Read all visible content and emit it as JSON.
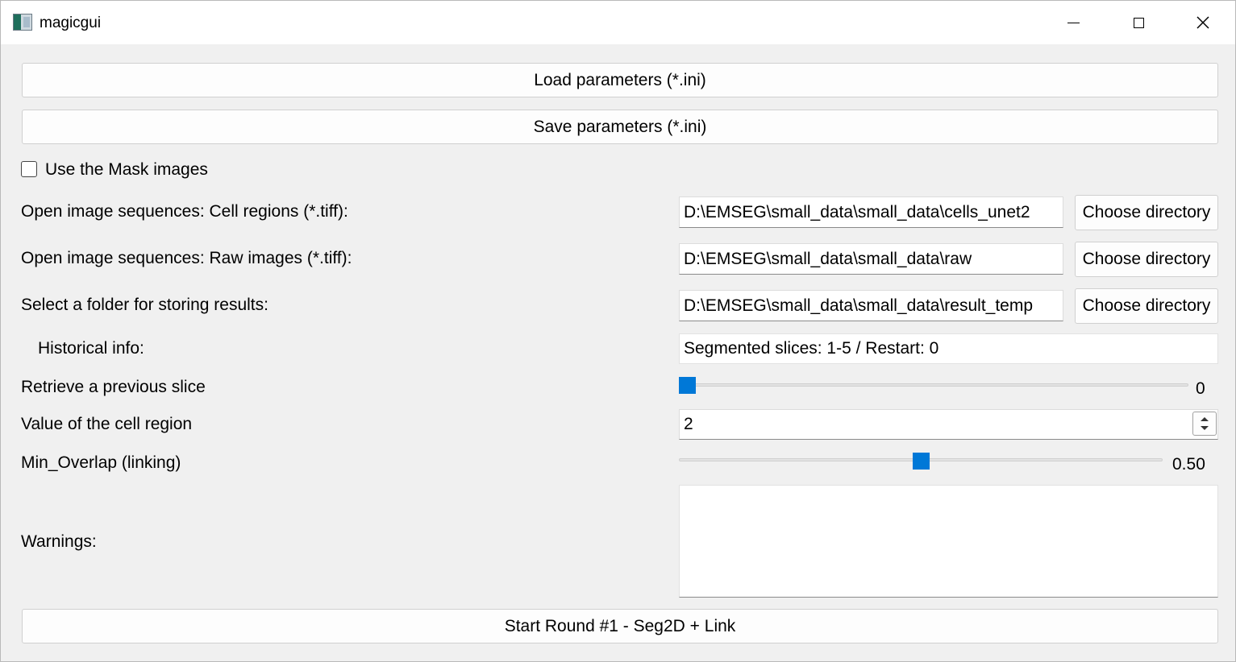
{
  "window": {
    "title": "magicgui"
  },
  "buttons": {
    "load_params": "Load parameters (*.ini)",
    "save_params": "Save parameters (*.ini)",
    "start_round": "Start Round #1 - Seg2D + Link"
  },
  "mask_checkbox": {
    "label": "Use the Mask images",
    "checked": false
  },
  "fields": {
    "cell_regions": {
      "label": "Open image sequences: Cell regions (*.tiff):",
      "value": "D:\\EMSEG\\small_data\\small_data\\cells_unet2",
      "button": "Choose directory"
    },
    "raw_images": {
      "label": "Open image sequences: Raw images (*.tiff):",
      "value": "D:\\EMSEG\\small_data\\small_data\\raw",
      "button": "Choose directory"
    },
    "results_folder": {
      "label": "Select a folder for storing results:",
      "value": "D:\\EMSEG\\small_data\\small_data\\result_temp",
      "button": "Choose directory"
    }
  },
  "historical_info": {
    "label": "Historical info:",
    "value": "Segmented slices: 1-5 / Restart: 0"
  },
  "retrieve_slice": {
    "label": "Retrieve a previous slice",
    "value": "0",
    "min": 0,
    "max": 100,
    "current": 0
  },
  "cell_region_value": {
    "label": "Value of the cell region",
    "value": "2"
  },
  "min_overlap": {
    "label": "Min_Overlap (linking)",
    "value": "0.50",
    "fraction": 0.5
  },
  "warnings": {
    "label": "Warnings:",
    "text": ""
  },
  "colors": {
    "accent": "#0078d7",
    "background": "#f0f0f0"
  },
  "icons": {
    "app": "app-icon",
    "minimize": "minimize-icon",
    "maximize": "maximize-icon",
    "close": "close-icon"
  }
}
